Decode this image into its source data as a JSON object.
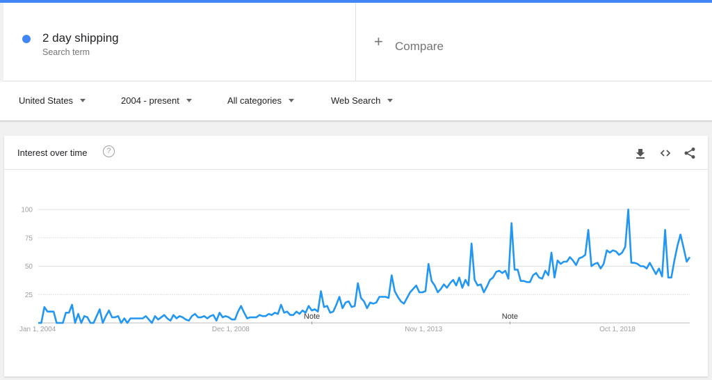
{
  "search_term": {
    "name": "2 day shipping",
    "subtitle": "Search term",
    "color": "#4285f4"
  },
  "compare": {
    "icon": "plus-icon",
    "label": "Compare"
  },
  "filters": [
    {
      "label": "United States"
    },
    {
      "label": "2004 - present"
    },
    {
      "label": "All categories"
    },
    {
      "label": "Web Search"
    }
  ],
  "card": {
    "title": "Interest over time",
    "help_icon": "help-circle-icon",
    "actions": [
      "download-icon",
      "embed-code-icon",
      "share-icon"
    ]
  },
  "chart_data": {
    "type": "line",
    "title": "Interest over time",
    "xlabel": "",
    "ylabel": "",
    "ylim": [
      0,
      100
    ],
    "yticks": [
      25,
      50,
      75,
      100
    ],
    "xtick_labels": [
      "Jan 1, 2004",
      "Dec 1, 2008",
      "Nov 1, 2013",
      "Oct 1, 2018"
    ],
    "annotations": [
      {
        "label": "Note",
        "position": 0.42
      },
      {
        "label": "Note",
        "position": 0.724
      }
    ],
    "grid": true,
    "color": "#2196f3",
    "series": [
      {
        "name": "2 day shipping",
        "values": [
          0,
          0,
          14,
          10,
          10,
          10,
          0,
          0,
          0,
          9,
          9,
          16,
          0,
          8,
          0,
          6,
          5,
          0,
          0,
          6,
          12,
          0,
          6,
          11,
          5,
          5,
          6,
          0,
          4,
          0,
          4,
          4,
          4,
          4,
          4,
          6,
          3,
          0,
          6,
          3,
          5,
          7,
          4,
          2,
          7,
          4,
          6,
          5,
          3,
          2,
          6,
          8,
          5,
          5,
          6,
          4,
          6,
          7,
          2,
          9,
          5,
          6,
          5,
          3,
          3,
          10,
          15,
          9,
          4,
          5,
          5,
          5,
          7,
          6,
          6,
          8,
          7,
          9,
          8,
          16,
          9,
          10,
          7,
          7,
          10,
          8,
          11,
          9,
          15,
          11,
          12,
          10,
          28,
          14,
          15,
          9,
          10,
          16,
          23,
          13,
          18,
          19,
          14,
          15,
          35,
          22,
          19,
          13,
          18,
          17,
          18,
          23,
          23,
          23,
          22,
          42,
          28,
          23,
          19,
          17,
          22,
          27,
          30,
          33,
          27,
          27,
          28,
          52,
          37,
          33,
          27,
          30,
          34,
          31,
          35,
          38,
          33,
          40,
          31,
          38,
          33,
          70,
          38,
          33,
          34,
          27,
          32,
          38,
          40,
          45,
          46,
          44,
          46,
          39,
          88,
          47,
          47,
          37,
          37,
          36,
          36,
          42,
          44,
          40,
          39,
          46,
          42,
          62,
          40,
          55,
          52,
          54,
          54,
          58,
          55,
          51,
          57,
          58,
          60,
          82,
          50,
          52,
          53,
          48,
          52,
          64,
          62,
          64,
          63,
          60,
          62,
          67,
          100,
          53,
          53,
          52,
          50,
          50,
          48,
          53,
          48,
          43,
          48,
          41,
          82,
          40,
          40,
          55,
          68,
          78,
          66,
          54,
          58
        ]
      }
    ]
  }
}
